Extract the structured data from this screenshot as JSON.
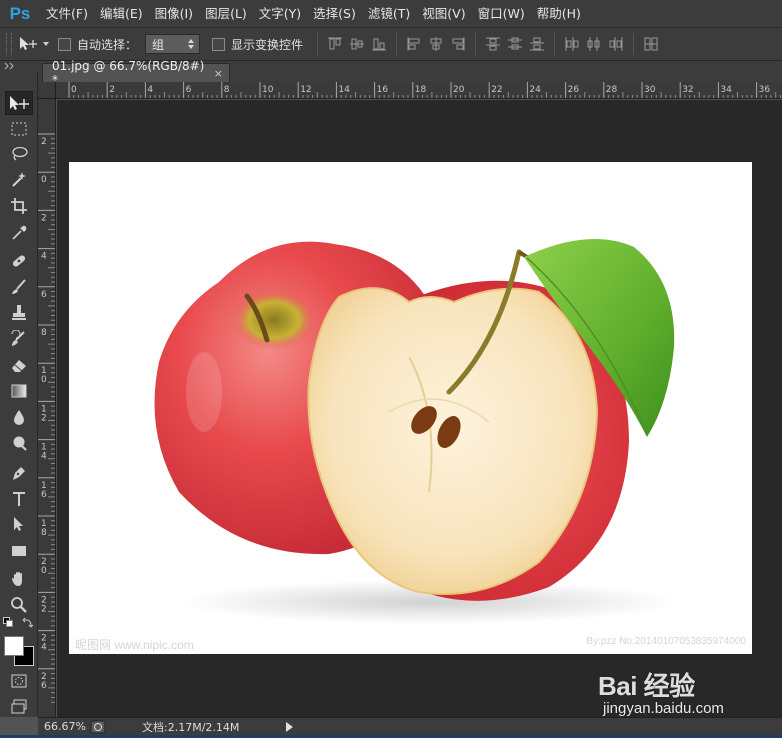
{
  "app": {
    "logo": "Ps"
  },
  "menu": [
    {
      "label": "文件(F)"
    },
    {
      "label": "编辑(E)"
    },
    {
      "label": "图像(I)"
    },
    {
      "label": "图层(L)"
    },
    {
      "label": "文字(Y)"
    },
    {
      "label": "选择(S)"
    },
    {
      "label": "滤镜(T)"
    },
    {
      "label": "视图(V)"
    },
    {
      "label": "窗口(W)"
    },
    {
      "label": "帮助(H)"
    }
  ],
  "options": {
    "auto_select_label": "自动选择：",
    "auto_select_checked": false,
    "auto_select_mode": "组",
    "show_transform_label": "显示变换控件",
    "show_transform_checked": false
  },
  "document": {
    "tab_title": "01.jpg @ 66.7%(RGB/8#) *",
    "close_glyph": "×"
  },
  "ruler": {
    "top_ticks": [
      "0",
      "2",
      "4",
      "6",
      "8",
      "10",
      "12",
      "14",
      "16",
      "18",
      "20",
      "22",
      "24",
      "26",
      "28",
      "30",
      "32",
      "34",
      "36"
    ],
    "left_ticks": [
      "2",
      "0",
      "2",
      "4",
      "6",
      "8",
      "10",
      "12",
      "14",
      "16",
      "18",
      "20",
      "22",
      "24",
      "26"
    ]
  },
  "image": {
    "watermark_left": "昵图网 www.nipic.com",
    "watermark_right": "By:pzz No.20140107053835974000"
  },
  "status": {
    "zoom": "66.67%",
    "doc_info": "文档:2.17M/2.14M"
  },
  "overlay": {
    "baidu_logo": "Bai 经验",
    "baidu_url": "jingyan.baidu.com"
  },
  "colors": {
    "ps_blue": "#2fa3e6",
    "panel_bg": "#3c3c3c",
    "canvas_bg": "#282828",
    "foreground": "#ffffff",
    "background": "#000000"
  },
  "tools": [
    {
      "name": "move-tool-icon"
    },
    {
      "name": "marquee-tool-icon"
    },
    {
      "name": "lasso-tool-icon"
    },
    {
      "name": "magic-wand-tool-icon"
    },
    {
      "name": "crop-tool-icon"
    },
    {
      "name": "eyedropper-tool-icon"
    },
    {
      "name": "healing-brush-tool-icon"
    },
    {
      "name": "brush-tool-icon"
    },
    {
      "name": "clone-stamp-tool-icon"
    },
    {
      "name": "history-brush-tool-icon"
    },
    {
      "name": "eraser-tool-icon"
    },
    {
      "name": "gradient-tool-icon"
    },
    {
      "name": "blur-tool-icon"
    },
    {
      "name": "dodge-tool-icon"
    },
    {
      "name": "pen-tool-icon"
    },
    {
      "name": "type-tool-icon"
    },
    {
      "name": "path-selection-tool-icon"
    },
    {
      "name": "rectangle-tool-icon"
    },
    {
      "name": "hand-tool-icon"
    },
    {
      "name": "zoom-tool-icon"
    }
  ]
}
